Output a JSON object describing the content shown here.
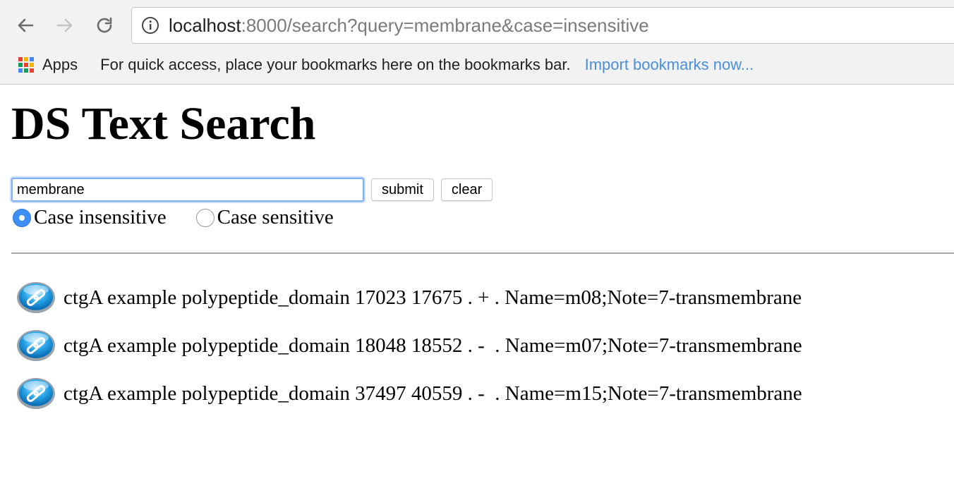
{
  "browser": {
    "url_host": "localhost",
    "url_rest": ":8000/search?query=membrane&case=insensitive",
    "bookmarks": {
      "apps_label": "Apps",
      "hint": "For quick access, place your bookmarks here on the bookmarks bar.",
      "import_link": "Import bookmarks now..."
    }
  },
  "page": {
    "title": "DS Text Search",
    "search": {
      "value": "membrane",
      "submit_label": "submit",
      "clear_label": "clear"
    },
    "case_options": [
      {
        "label": "Case insensitive",
        "selected": true
      },
      {
        "label": "Case sensitive",
        "selected": false
      }
    ],
    "results": [
      {
        "text": "ctgA example polypeptide_domain 17023 17675 . + . Name=m08;Note=7-transmembrane",
        "icon": "link-icon"
      },
      {
        "text": "ctgA example polypeptide_domain 18048 18552 . -  . Name=m07;Note=7-transmembrane",
        "icon": "link-icon"
      },
      {
        "text": "ctgA example polypeptide_domain 37497 40559 . -  . Name=m15;Note=7-transmembrane",
        "icon": "link-icon"
      }
    ]
  },
  "colors": {
    "accent": "#3d8ef5",
    "link": "#4a8fdb"
  }
}
